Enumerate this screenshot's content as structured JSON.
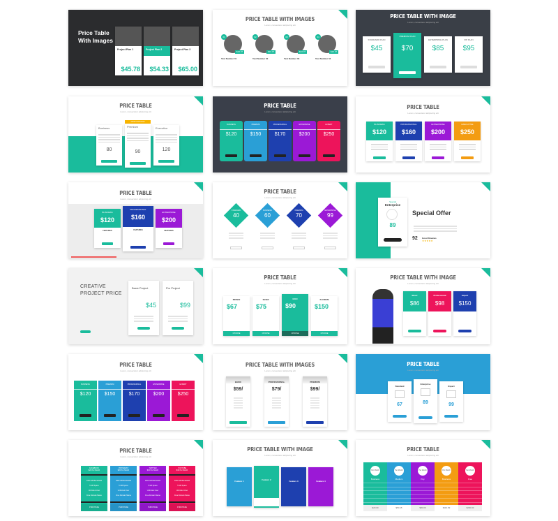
{
  "colors": {
    "teal": "#1abc9c",
    "blue": "#2a9fd6",
    "navy": "#1e40af",
    "purple": "#9b19d6",
    "pink": "#ed145b",
    "orange": "#f39c12",
    "dark": "#2d2f33",
    "yellow": "#f9b500"
  },
  "slides": [
    {
      "title": "Price Table With Images",
      "plans": [
        {
          "name": "Project Plan 1",
          "price": "$45.78"
        },
        {
          "name": "Project Plan 2",
          "price": "$54.33"
        },
        {
          "name": "Project Plan 3",
          "price": "$65.00"
        }
      ]
    },
    {
      "title": "PRICE TABLE WITH IMAGES",
      "subtitle": "Lorem, consectetur adipiscing elit",
      "items": [
        {
          "num": "01",
          "label": "Text Number 01",
          "price": "$16.07"
        },
        {
          "num": "02",
          "label": "Text Number 02",
          "price": "$16.07"
        },
        {
          "num": "03",
          "label": "Text Number 03",
          "price": "$16.07"
        },
        {
          "num": "04",
          "label": "Text Number 04",
          "price": "$16.07"
        }
      ]
    },
    {
      "title": "PRICE TABLE WITH IMAGE",
      "subtitle": "Lorem, consectetur adipiscing elit",
      "plans": [
        {
          "name": "STANDARD PLAN",
          "price": "$45"
        },
        {
          "name": "PREMIUM PLAN",
          "price": "$70"
        },
        {
          "name": "ENTERPRISE PLAN",
          "price": "$85"
        },
        {
          "name": "VIP PLAN",
          "price": "$95"
        }
      ]
    },
    {
      "title": "PRICE TABLE",
      "subtitle": "Lorem, consectetur adipiscing elit",
      "badge": "MOST POPULAR",
      "plans": [
        {
          "name": "Business",
          "price": "80"
        },
        {
          "name": "Premium",
          "price": "90"
        },
        {
          "name": "Executive",
          "price": "120"
        }
      ]
    },
    {
      "title": "PRICE TABLE",
      "subtitle": "Lorem, consectetur adipiscing elit",
      "button": "ORDER NOW",
      "plans": [
        {
          "name": "BUSINESS",
          "price": "$120"
        },
        {
          "name": "PREMIUM",
          "price": "$150"
        },
        {
          "name": "PROFESSIONAL",
          "price": "$170"
        },
        {
          "name": "ENTERPRISE",
          "price": "$200"
        },
        {
          "name": "EXPERT",
          "price": "$250"
        }
      ]
    },
    {
      "title": "PRICE TABLE",
      "subtitle": "Lorem, consectetur adipiscing elit",
      "plans": [
        {
          "name": "BUSINESS",
          "price": "$120"
        },
        {
          "name": "PROFESSIONAL",
          "price": "$160"
        },
        {
          "name": "ENTERPRISE",
          "price": "$200"
        },
        {
          "name": "EXECUTIVE",
          "price": "$250"
        }
      ]
    },
    {
      "title": "PRICE TABLE",
      "subtitle": "Lorem, consectetur adipiscing elit",
      "feature_label": "FEATURES",
      "plans": [
        {
          "name": "BUSINESS",
          "price": "$120"
        },
        {
          "name": "PROFESSIONAL",
          "price": "$160"
        },
        {
          "name": "ENTERPRISE",
          "price": "$200"
        }
      ]
    },
    {
      "title": "PRICE TABLE",
      "subtitle": "Lorem, consectetur adipiscing elit",
      "plans": [
        {
          "name": "STANDARD",
          "price": "40"
        },
        {
          "name": "BUSINESS",
          "price": "60"
        },
        {
          "name": "PREMIUM",
          "price": "70"
        },
        {
          "name": "ENTERPRISE",
          "price": "99"
        }
      ]
    },
    {
      "card_label": "Special",
      "card_name": "Enterprise",
      "price": "89",
      "heading": "Special Offer",
      "score": "92",
      "score_label": "Good Reviews",
      "stars": "★★★★★"
    },
    {
      "title": "CREATIVE PROJECT PRICE",
      "plans": [
        {
          "name": "Basic Project",
          "price": "$45",
          "cents": "99"
        },
        {
          "name": "Pro Project",
          "price": "$99",
          "cents": "99"
        }
      ]
    },
    {
      "title": "PRICE TABLE",
      "subtitle": "Lorem, consectetur adipiscing elit",
      "button": "CHOOSE",
      "plans": [
        {
          "name": "BRONZE",
          "price": "$67"
        },
        {
          "name": "SILVER",
          "price": "$75"
        },
        {
          "name": "GOLD",
          "price": "$90"
        },
        {
          "name": "PLATINUM",
          "price": "$150"
        }
      ]
    },
    {
      "title": "PRICE TABLE WITH IMAGE",
      "subtitle": "Lorem, consectetur adipiscing elit",
      "plans": [
        {
          "name": "Basic",
          "price": "$86"
        },
        {
          "name": "Professional",
          "price": "$98"
        },
        {
          "name": "Expert",
          "price": "$150"
        }
      ]
    },
    {
      "title": "PRICE TABLE",
      "subtitle": "Lorem, consectetur adipiscing elit",
      "plans": [
        {
          "name": "BUSINESS",
          "price": "$120"
        },
        {
          "name": "PREMIUM",
          "price": "$150"
        },
        {
          "name": "PROFESSIONAL",
          "price": "$170"
        },
        {
          "name": "ENTERPRISE",
          "price": "$200"
        },
        {
          "name": "EXPERT",
          "price": "$250"
        }
      ]
    },
    {
      "title": "PRICE TABLE WITH IMAGES",
      "subtitle": "Lorem, consectetur adipiscing elit",
      "plans": [
        {
          "name": "BASIC",
          "price": "$59/"
        },
        {
          "name": "PROFESSIONAL",
          "price": "$79/"
        },
        {
          "name": "PREMIUM",
          "price": "$99/"
        }
      ]
    },
    {
      "title": "PRICE TABLE",
      "subtitle": "Lorem, consectetur adipiscing elit",
      "plans": [
        {
          "name": "Standard",
          "price": "67"
        },
        {
          "name": "Enterprise",
          "price": "89"
        },
        {
          "name": "Expert",
          "price": "99"
        }
      ]
    },
    {
      "title": "PRICE TABLE",
      "subtitle": "Lorem, consectetur adipiscing elit",
      "button": "PURCHASE",
      "plans": [
        {
          "name": "FACEBOOK",
          "sub": "$20 Per Month"
        },
        {
          "name": "PINTEREST",
          "sub": "$20 Per Month"
        },
        {
          "name": "TWITTER",
          "sub": "$40 Per Month"
        },
        {
          "name": "YOUTUBE",
          "sub": "$40 Per Month"
        }
      ],
      "features": [
        "1000 GB Bandwidth",
        "5 GB Space",
        "Unlimited User",
        "Free Domain Name"
      ]
    },
    {
      "title": "PRICE TABLE WITH IMAGE",
      "subtitle": "Lorem, consectetur adipiscing elit",
      "plans": [
        {
          "name": "Feature 1"
        },
        {
          "name": "Feature 2"
        },
        {
          "name": "Feature 3"
        },
        {
          "name": "Feature 4"
        }
      ]
    },
    {
      "title": "PRICE TABLE",
      "subtitle": "Lorem, consectetur adipiscing elit",
      "circle": "Per Month",
      "plans": [
        {
          "name": "Business",
          "price": "$20.00"
        },
        {
          "name": "Medium",
          "price": "$50.15"
        },
        {
          "name": "Pay",
          "price": "$80.00"
        },
        {
          "name": "Business",
          "price": "$110.99"
        },
        {
          "name": "Free",
          "price": "$200.00"
        }
      ]
    }
  ]
}
